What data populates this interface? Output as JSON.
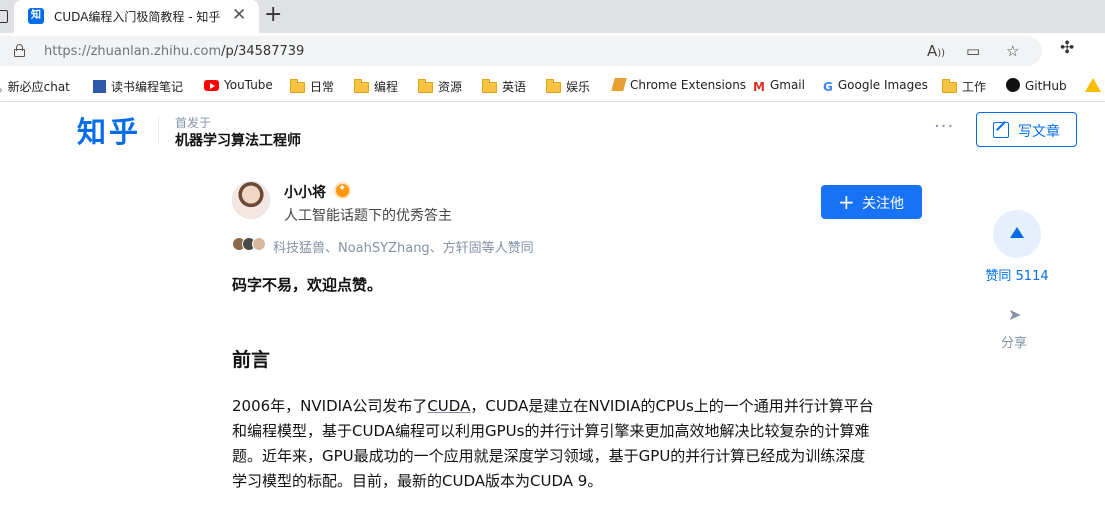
{
  "browser": {
    "tab_title": "CUDA编程入门极简教程 - 知乎",
    "favicon_char": "知",
    "url_host": "https://zhuanlan.zhihu.com",
    "url_path": "/p/34587739"
  },
  "bookmarks": [
    {
      "label": "新必应chat",
      "icon": "search-icon"
    },
    {
      "label": "读书编程笔记",
      "icon": "qr-icon"
    },
    {
      "label": "YouTube",
      "icon": "youtube-icon"
    },
    {
      "label": "日常",
      "icon": "folder-icon"
    },
    {
      "label": "编程",
      "icon": "folder-icon"
    },
    {
      "label": "资源",
      "icon": "folder-icon"
    },
    {
      "label": "英语",
      "icon": "folder-icon"
    },
    {
      "label": "娱乐",
      "icon": "folder-icon"
    },
    {
      "label": "Chrome Extensions",
      "icon": "chrome-extension-icon"
    },
    {
      "label": "Gmail",
      "icon": "gmail-icon"
    },
    {
      "label": "Google Images",
      "icon": "google-icon"
    },
    {
      "label": "工作",
      "icon": "folder-icon"
    },
    {
      "label": "GitHub",
      "icon": "github-icon"
    }
  ],
  "header": {
    "logo": "知乎",
    "first_published_label": "首发于",
    "column_name": "机器学习算法工程师",
    "write_label": "写文章"
  },
  "author": {
    "name": "小小将",
    "bio": "人工智能话题下的优秀答主",
    "follow_label": "关注他"
  },
  "voters_text": "科技猛兽、NoahSYZhang、方轩固等人赞同",
  "article": {
    "lead": "码字不易，欢迎点赞。",
    "section_title": "前言",
    "para_1a": "2006年，NVIDIA公司发布了",
    "para_link": "CUDA",
    "para_1b": "，CUDA是建立在NVIDIA的CPUs上的一个通用并行计算平台",
    "para_2": "和编程模型，基于CUDA编程可以利用GPUs的并行计算引擎来更加高效地解决比较复杂的计算难",
    "para_3": "题。近年来，GPU最成功的一个应用就是深度学习领域，基于GPU的并行计算已经成为训练深度",
    "para_4": "学习模型的标配。目前，最新的CUDA版本为CUDA 9。"
  },
  "side_actions": {
    "vote_label": "赞同 5114",
    "share_label": "分享"
  },
  "colors": {
    "brand": "#056de8",
    "button_primary": "#1772f6",
    "muted": "#8590a6"
  }
}
